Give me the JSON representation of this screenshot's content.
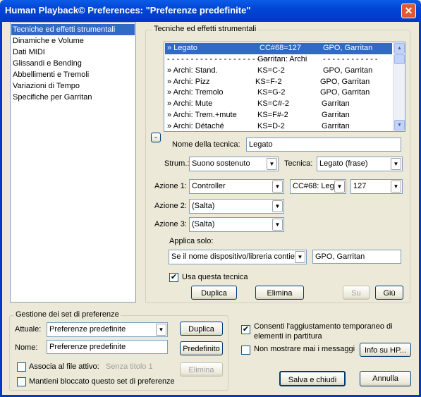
{
  "window": {
    "title": "Human Playback© Preferences: \"Preferenze predefinite\"",
    "close_label": "✕"
  },
  "categories": [
    {
      "label": "Tecniche ed effetti strumentali",
      "selected": true
    },
    {
      "label": "Dinamiche e Volume"
    },
    {
      "label": "Dati MIDI"
    },
    {
      "label": "Glissandi e Bending"
    },
    {
      "label": "Abbellimenti e Tremoli"
    },
    {
      "label": "Variazioni di Tempo"
    },
    {
      "label": "Specifiche per Garritan"
    }
  ],
  "techniques": {
    "group_label": "Tecniche ed effetti strumentali",
    "rows": [
      {
        "name": "» Legato",
        "action": "CC#68=127",
        "lib": "GPO, Garritan",
        "selected": true
      },
      {
        "name": "- - - - - - - - - - - - - - - - - - - - - -",
        "action": "Garritan: Archi",
        "lib": "- - - - - - - - - - - -"
      },
      {
        "name": "» Archi: Stand.",
        "action": "KS=C-2",
        "lib": "GPO, Garritan"
      },
      {
        "name": "» Archi: Pizz",
        "action": "KS=F-2",
        "lib": "GPO, Garritan"
      },
      {
        "name": "» Archi: Tremolo",
        "action": "KS=G-2",
        "lib": "GPO, Garritan"
      },
      {
        "name": "» Archi: Mute",
        "action": "KS=C#-2",
        "lib": "Garritan"
      },
      {
        "name": "» Archi: Trem.+mute",
        "action": "KS=F#-2",
        "lib": "Garritan"
      },
      {
        "name": "» Archi: Détaché",
        "action": "KS=D-2",
        "lib": "Garritan"
      }
    ],
    "collapse_label": "-",
    "name_label": "Nome della tecnica:",
    "name_value": "Legato",
    "strum_label": "Strum.:",
    "strum_value": "Suono sostenuto",
    "tecnica_label": "Tecnica:",
    "tecnica_value": "Legato (frase)",
    "azione1_label": "Azione 1:",
    "azione1_value": "Controller",
    "azione1_cc": "CC#68: Leg",
    "azione1_val": "127",
    "azione2_label": "Azione 2:",
    "azione2_value": "(Salta)",
    "azione3_label": "Azione 3:",
    "azione3_value": "(Salta)",
    "applica_label": "Applica solo:",
    "applica_value": "Se il nome dispositivo/libreria contien",
    "applica_text": "GPO, Garritan",
    "usa_label": "Usa questa tecnica",
    "usa_checked": "✔",
    "duplica_label": "Duplica",
    "elimina_label": "Elimina",
    "su_label": "Su",
    "giu_label": "Giù"
  },
  "presets": {
    "group_label": "Gestione dei set di preferenze",
    "attuale_label": "Attuale:",
    "attuale_value": "Preferenze predefinite",
    "duplica_label": "Duplica",
    "nome_label": "Nome:",
    "nome_value": "Preferenze predefinite",
    "predefinito_label": "Predefinito",
    "associa_label": "Associa al file attivo:",
    "associa_file": "Senza titolo 1",
    "elimina_label": "Elimina",
    "mantieni_label": "Mantieni bloccato questo set di preferenze"
  },
  "options": {
    "consenti_label_1": "Consenti l'aggiustamento temporaneo di",
    "consenti_label_2": "elementi in partitura",
    "consenti_checked": "✔",
    "non_mostrare_label": "Non mostrare mai i messaggi",
    "info_label": "Info su HP...",
    "salva_label": "Salva e chiudi",
    "annulla_label": "Annulla"
  }
}
